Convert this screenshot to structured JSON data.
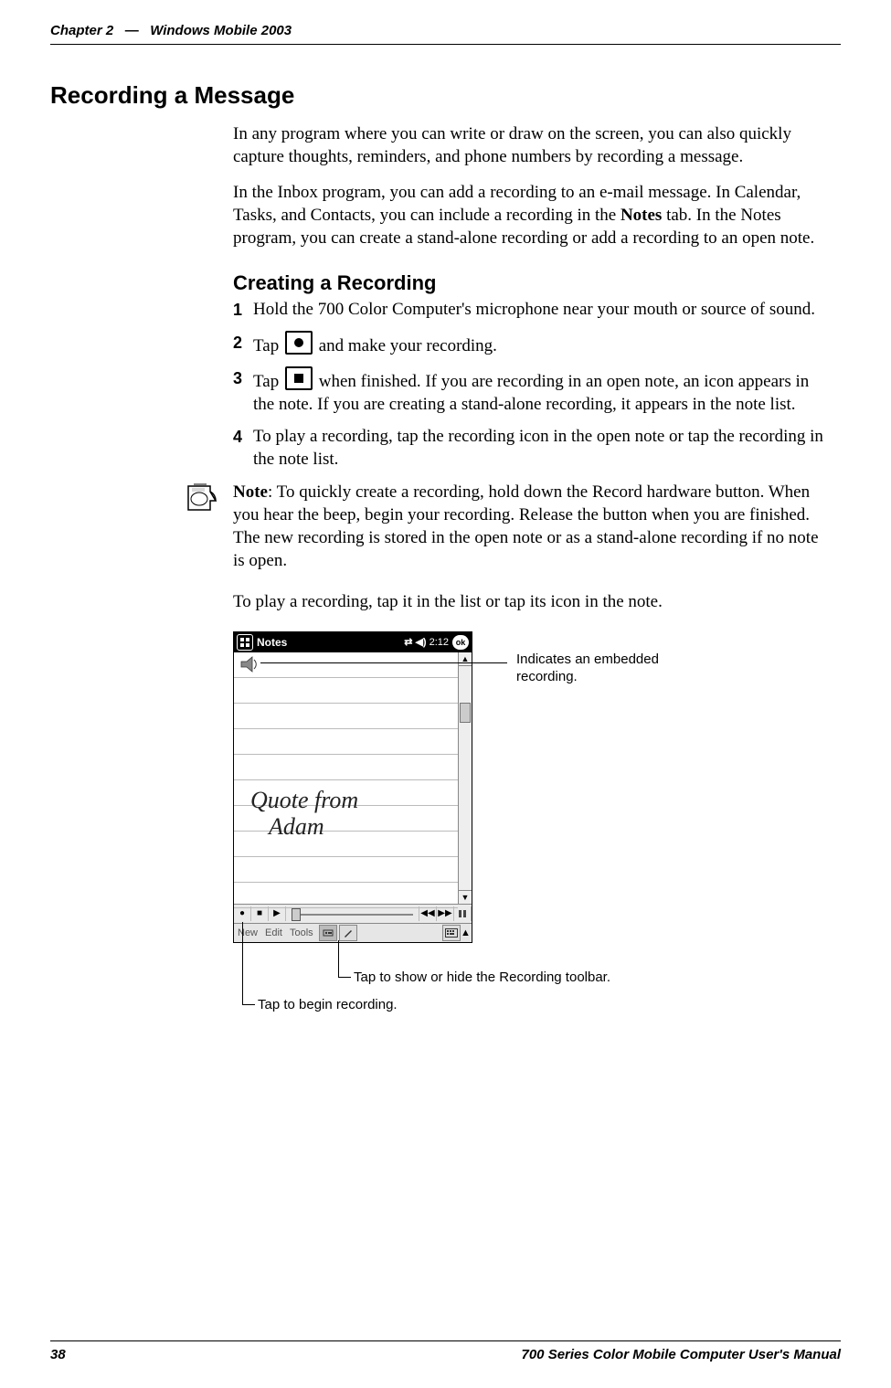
{
  "header": {
    "chapter_label": "Chapter 2",
    "separator": "—",
    "title": "Windows Mobile 2003"
  },
  "h1": "Recording a Message",
  "intro_para_1": "In any program where you can write or draw on the screen, you can also quickly capture thoughts, reminders, and phone numbers by recording a message.",
  "intro_para_2_a": "In the Inbox program, you can add a recording to an e-mail message. In Calendar, Tasks, and Contacts, you can include a recording in the ",
  "intro_para_2_bold": "Notes",
  "intro_para_2_b": " tab. In the Notes program, you can create a stand-alone recording or add a recording to an open note.",
  "h2": "Creating a Recording",
  "steps": [
    {
      "num": "1",
      "text": "Hold the 700 Color Computer's microphone near your mouth or source of sound."
    },
    {
      "num": "2",
      "pre": "Tap ",
      "icon": "record",
      "post": " and make your recording."
    },
    {
      "num": "3",
      "pre": "Tap ",
      "icon": "stop",
      "post": " when finished. If you are recording in an open note, an icon appears in the note. If you are creating a stand-alone recording, it appears in the note list."
    },
    {
      "num": "4",
      "text": "To play a recording, tap the recording icon in the open note or tap the recording in the note list."
    }
  ],
  "note": {
    "label": "Note",
    "text": ": To quickly create a recording, hold down the Record hardware button. When you hear the beep, begin your recording. Release the button when you are finished. The new recording is stored in the open note or as a stand-alone recording if no note is open."
  },
  "play_para": "To play a recording, tap it in the list or tap its icon in the note.",
  "screenshot": {
    "titlebar": {
      "app": "Notes",
      "time": "2:12",
      "ok": "ok"
    },
    "handwriting_line1": "Quote from",
    "handwriting_line2": "Adam",
    "menubar": {
      "new": "New",
      "edit": "Edit",
      "tools": "Tools"
    }
  },
  "callouts": {
    "embedded": "Indicates an embedded recording.",
    "toolbar": "Tap to show or hide the Recording toolbar.",
    "begin": "Tap to begin recording."
  },
  "footer": {
    "page": "38",
    "manual": "700 Series Color Mobile Computer User's Manual"
  }
}
